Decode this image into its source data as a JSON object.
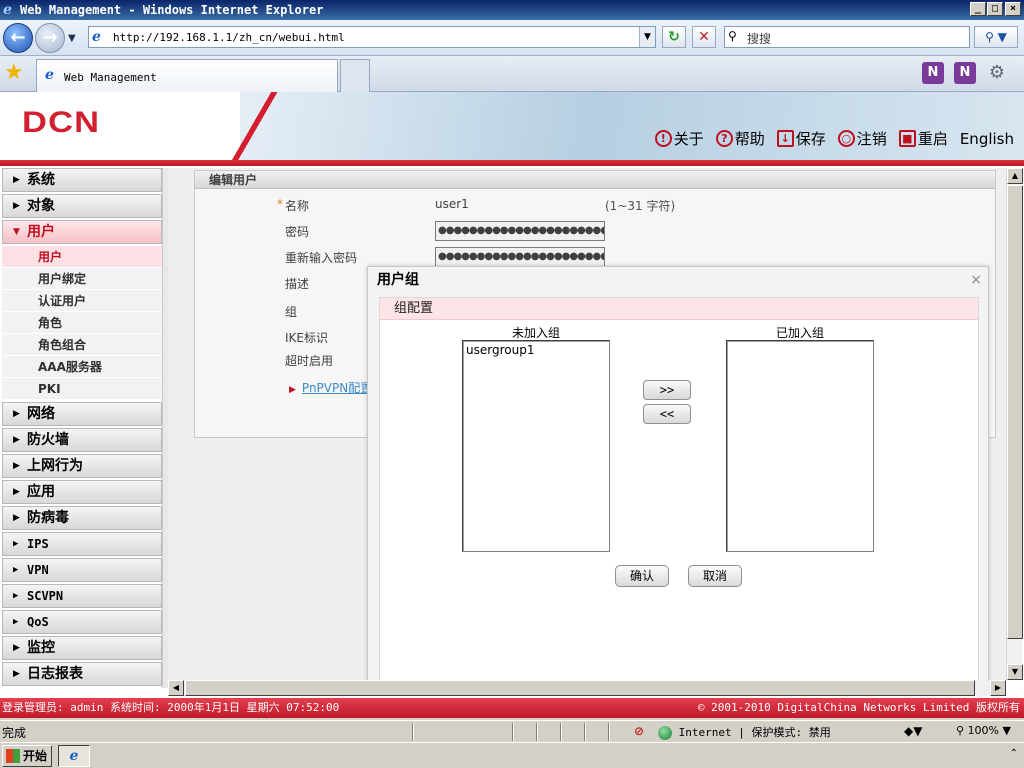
{
  "window": {
    "title": "Web Management - Windows Internet Explorer",
    "minimize": "_",
    "maximize": "□",
    "close": "×"
  },
  "browser": {
    "url": "http://192.168.1.1/zh_cn/webui.html",
    "search_placeholder": "搜搜",
    "tab_title": "Web Management",
    "status_text": "完成",
    "zone_text": "Internet | 保护模式: 禁用",
    "zoom": "100%"
  },
  "header": {
    "logo": "DCN",
    "links": [
      {
        "label": "关于",
        "icon": "!"
      },
      {
        "label": "帮助",
        "icon": "?"
      },
      {
        "label": "保存",
        "icon": "↓"
      },
      {
        "label": "注销",
        "icon": "○"
      },
      {
        "label": "重启",
        "icon": "■"
      },
      {
        "label": "English",
        "icon": ""
      }
    ]
  },
  "sidebar": {
    "top_items": [
      {
        "label": "系统"
      },
      {
        "label": "对象"
      }
    ],
    "open_item": {
      "label": "用户"
    },
    "sub_items": [
      {
        "label": "用户",
        "active": true
      },
      {
        "label": "用户绑定"
      },
      {
        "label": "认证用户"
      },
      {
        "label": "角色"
      },
      {
        "label": "角色组合"
      },
      {
        "label": "AAA服务器"
      },
      {
        "label": "PKI"
      }
    ],
    "bottom_items": [
      {
        "label": "网络"
      },
      {
        "label": "防火墙"
      },
      {
        "label": "上网行为"
      },
      {
        "label": "应用"
      },
      {
        "label": "防病毒"
      },
      {
        "label": "IPS",
        "latin": true
      },
      {
        "label": "VPN",
        "latin": true
      },
      {
        "label": "SCVPN",
        "latin": true
      },
      {
        "label": "QoS",
        "latin": true
      },
      {
        "label": "监控"
      },
      {
        "label": "日志报表"
      }
    ]
  },
  "edit_user": {
    "title": "编辑用户",
    "name_label": "名称",
    "name_value": "user1",
    "name_hint": "(1~31 字符)",
    "password_label": "密码",
    "password_mask": "●●●●●●●●●●●●●●●●●●●●●●●●",
    "confirm_label": "重新输入密码",
    "confirm_mask": "●●●●●●●●●●●●●●●●●●●●●●●●",
    "desc_label": "描述",
    "group_label": "组",
    "ike_label": "IKE标识",
    "timeout_label": "超时启用",
    "pnpvpn_link": "PnPVPN配置"
  },
  "modal": {
    "title": "用户组",
    "close": "×",
    "section": "组配置",
    "left_title": "未加入组",
    "right_title": "已加入组",
    "available_groups": [
      "usergroup1"
    ],
    "joined_groups": [],
    "add_btn": ">>",
    "remove_btn": "<<",
    "ok_btn": "确认",
    "cancel_btn": "取消"
  },
  "footer": {
    "left": "登录管理员: admin 系统时间: 2000年1月1日 星期六 07:52:00",
    "right": "© 2001-2010 DigitalChina Networks Limited 版权所有"
  },
  "taskbar": {
    "start": "开始"
  }
}
